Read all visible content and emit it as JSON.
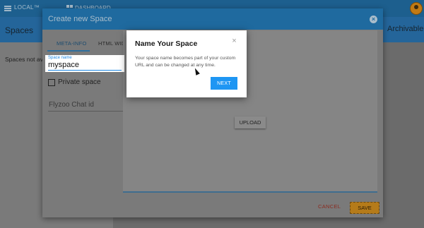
{
  "appbar": {
    "brand": "LOCAL™",
    "dashboard_label": "DASHBOARD"
  },
  "page": {
    "title": "Spaces",
    "archivable_label": "Archivable",
    "empty_text": "Spaces not available"
  },
  "dialog": {
    "title": "Create new Space",
    "tabs": [
      {
        "label": "META-INFO"
      },
      {
        "label": "HTML WIDGETS"
      }
    ],
    "space_name": {
      "label": "Space name",
      "value": "myspace"
    },
    "private_space": {
      "label": "Private space",
      "checked": false
    },
    "flyzoo": {
      "placeholder": "Flyzoo Chat id"
    },
    "upload_label": "UPLOAD",
    "cancel_label": "CANCEL",
    "save_label": "SAVE"
  },
  "modal": {
    "title": "Name Your Space",
    "body": "Your space name becomes part of your custom URL and can be changed at any time.",
    "next_label": "NEXT",
    "close_glyph": "×"
  },
  "icons": [
    "menu-icon",
    "dashboard-icon",
    "avatar",
    "close-icon"
  ],
  "colors": {
    "primary": "#1e96f3",
    "accent": "#b57b1a",
    "cancel": "#8b2b20"
  }
}
